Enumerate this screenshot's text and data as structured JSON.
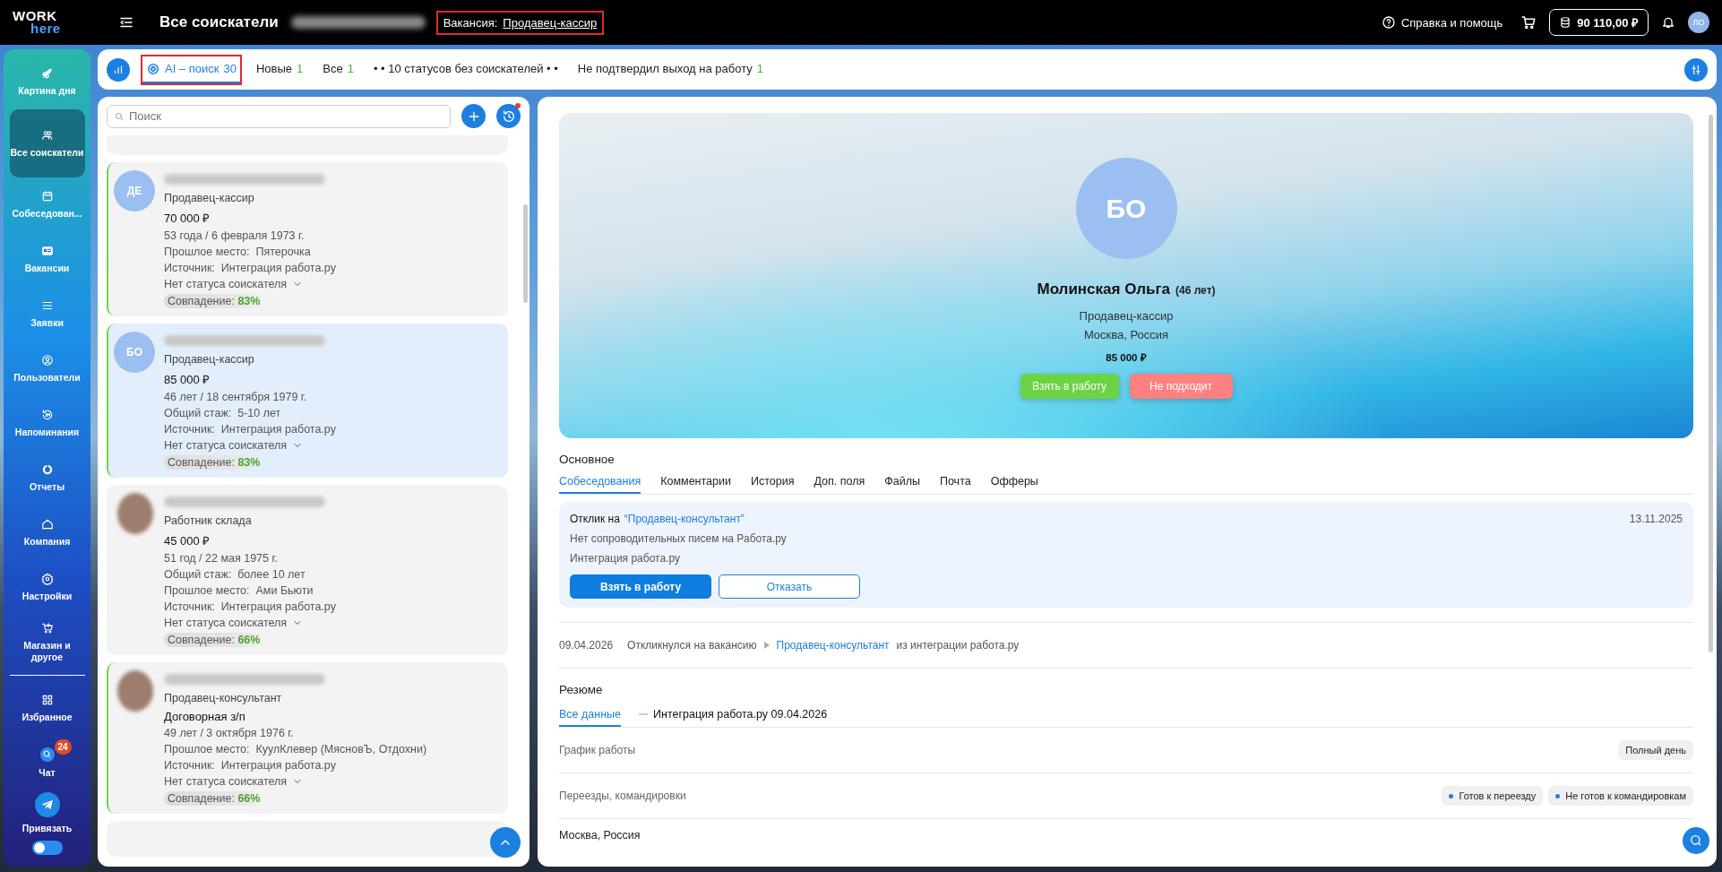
{
  "topbar": {
    "logo_top": "WORK",
    "logo_bottom": "here",
    "title": "Все соискатели",
    "vacancy_label": "Вакансия:",
    "vacancy": "Продавец-кассир",
    "vacancy_highlighted": true,
    "help": "Справка и помощь",
    "balance": "90 110,00 ₽",
    "user_initials": "ЛО"
  },
  "sidebar": {
    "items": [
      {
        "label": "Картина дня",
        "selected": false
      },
      {
        "label": "Все соискатели",
        "selected": true
      },
      {
        "label": "Собеседован...",
        "selected": false
      },
      {
        "label": "Вакансии",
        "selected": false
      },
      {
        "label": "Заявки",
        "selected": false
      },
      {
        "label": "Пользователи",
        "selected": false
      },
      {
        "label": "Напоминания",
        "selected": false
      },
      {
        "label": "Отчеты",
        "selected": false
      },
      {
        "label": "Компания",
        "selected": false
      },
      {
        "label": "Настройки",
        "selected": false
      },
      {
        "label": "Магазин и другое",
        "selected": false
      },
      {
        "label": "Избранное",
        "selected": false
      }
    ],
    "chat": {
      "label": "Чат",
      "badge": "24"
    },
    "bind": "Привязать",
    "dark_mode": false
  },
  "tabs_bar": {
    "tabs": [
      {
        "label": "AI – поиск",
        "count": "30",
        "selected": true,
        "highlighted": true
      },
      {
        "label": "Новые",
        "count": "1",
        "selected": false,
        "highlighted": false
      },
      {
        "label": "Все",
        "count": "1",
        "selected": false,
        "highlighted": false
      },
      {
        "label": "• • 10 статусов без соискателей • •",
        "selected": false,
        "highlighted": false
      },
      {
        "label": "Не подтвердил выход на работу",
        "count": "1",
        "selected": false,
        "highlighted": false
      }
    ]
  },
  "candidates": {
    "search_placeholder": "Поиск",
    "cards": [
      {
        "kind": "initials",
        "initials": "ДЕ",
        "new": true,
        "selected": false,
        "position": "Продавец-кассир",
        "salary": "70 000 ₽",
        "age": "53 года / 6 февраля 1973 г.",
        "fields": [
          {
            "label": "Прошлое место:",
            "value": "Пятерочка"
          },
          {
            "label": "Источник:",
            "value": "Интеграция работа.ру"
          }
        ],
        "status": "Нет статуса соискателя",
        "match_label": "Совпадение:",
        "match": "83%"
      },
      {
        "kind": "initials",
        "initials": "БО",
        "new": true,
        "selected": true,
        "position": "Продавец-кассир",
        "salary": "85 000 ₽",
        "age": "46 лет / 18 сентября 1979 г.",
        "fields": [
          {
            "label": "Общий стаж:",
            "value": "5-10 лет"
          },
          {
            "label": "Источник:",
            "value": "Интеграция работа.ру"
          }
        ],
        "status": "Нет статуса соискателя",
        "match_label": "Совпадение:",
        "match": "83%"
      },
      {
        "kind": "photo",
        "new": false,
        "selected": false,
        "position": "Работник склада",
        "salary": "45 000 ₽",
        "age": "51 год / 22 мая 1975 г.",
        "fields": [
          {
            "label": "Общий стаж:",
            "value": "более 10 лет"
          },
          {
            "label": "Прошлое место:",
            "value": "Ами Бьюти"
          },
          {
            "label": "Источник:",
            "value": "Интеграция работа.ру"
          }
        ],
        "status": "Нет статуса соискателя",
        "match_label": "Совпадение:",
        "match": "66%"
      },
      {
        "kind": "photo",
        "new": true,
        "selected": false,
        "position": "Продавец-консультант",
        "salary": "Договорная з/п",
        "age": "49 лет / 3 октября 1976 г.",
        "fields": [
          {
            "label": "Прошлое место:",
            "value": "КуулКлевер (МясновЪ, Отдохни)"
          },
          {
            "label": "Источник:",
            "value": "Интеграция работа.ру"
          }
        ],
        "status": "Нет статуса соискателя",
        "match_label": "Совпадение:",
        "match": "66%"
      }
    ]
  },
  "profile": {
    "initials": "БО",
    "name": "Молинская Ольга",
    "age": "(46 лет)",
    "position": "Продавец-кассир",
    "location": "Москва, Россия",
    "salary": "85 000 ₽",
    "accept": "Взять в работу",
    "reject": "Не подходит"
  },
  "details": {
    "section_title": "Основное",
    "tabs": [
      {
        "label": "Собеседования",
        "selected": true
      },
      {
        "label": "Комментарии",
        "selected": false
      },
      {
        "label": "История",
        "selected": false
      },
      {
        "label": "Доп. поля",
        "selected": false
      },
      {
        "label": "Файлы",
        "selected": false
      },
      {
        "label": "Почта",
        "selected": false
      },
      {
        "label": "Офферы",
        "selected": false
      }
    ],
    "response": {
      "prefix": "Отклик на",
      "vacancy": "“Продавец-консультант”",
      "date": "13.11.2025",
      "lines": [
        "Нет сопроводительных писем на Работа.ру",
        "Интеграция работа.ру"
      ],
      "accept": "Взять в работу",
      "reject": "Отказать"
    },
    "history": {
      "date": "09.04.2026",
      "action": "Откликнулся на вакансию",
      "vacancy": "Продавец-консультант",
      "source": "из интеграции работа.ру"
    }
  },
  "resume": {
    "title": "Резюме",
    "tabs": [
      {
        "label": "Все данные",
        "selected": true
      },
      {
        "label": "Интеграция работа.ру 09.04.2026",
        "selected": false
      }
    ],
    "rows": [
      {
        "kind": "field",
        "label": "График работы",
        "tags": [
          {
            "text": "Полный день",
            "dot": false
          }
        ]
      },
      {
        "kind": "field",
        "label": "Переезды, командировки",
        "tags": [
          {
            "text": "Готов к переезду",
            "dot": true
          },
          {
            "text": "Не готов к командировкам",
            "dot": true
          }
        ]
      },
      {
        "kind": "heading",
        "label": "Москва, Россия",
        "tags": []
      }
    ]
  }
}
